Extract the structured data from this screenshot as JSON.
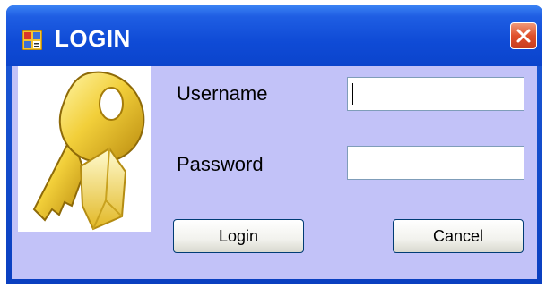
{
  "window": {
    "title": "LOGIN",
    "app_icon": "form-window-icon",
    "close_icon": "close-icon"
  },
  "form": {
    "username_label": "Username",
    "username_value": "",
    "password_label": "Password",
    "password_value": "",
    "login_label": "Login",
    "cancel_label": "Cancel",
    "image_icon": "key-icon"
  },
  "colors": {
    "titlebar": "#0b44cc",
    "client_background": "#c2c2f8",
    "close_button": "#e0502b"
  }
}
